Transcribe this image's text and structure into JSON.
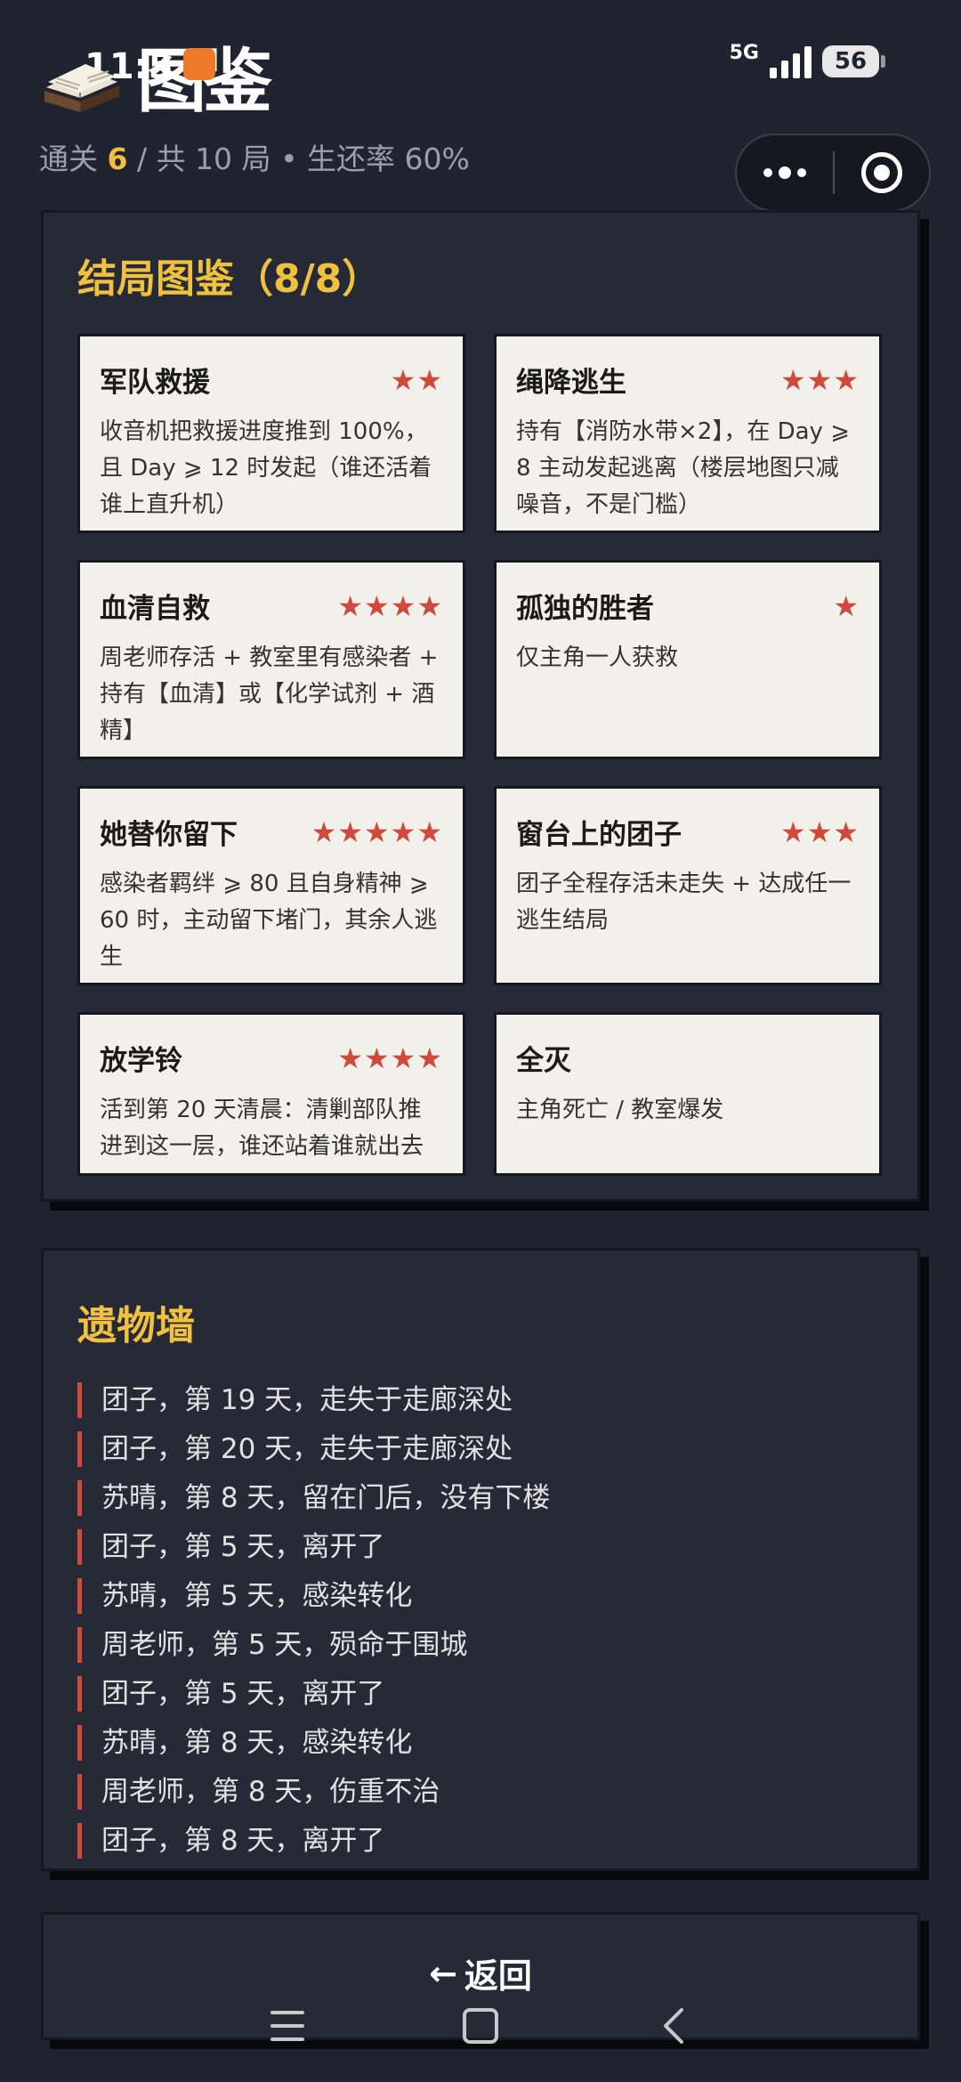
{
  "status_bar": {
    "time": "11:5",
    "network": "5G",
    "battery": "56"
  },
  "header": {
    "logo_text": "图鉴",
    "stats": {
      "cleared_label": "通关",
      "cleared_value": "6",
      "total_text": "/ 共 10 局",
      "separator": "•",
      "survival_text": "生还率 60%"
    }
  },
  "endings": {
    "title": "结局图鉴（8/8）",
    "cards": [
      {
        "title": "军队救援",
        "stars": "★★",
        "desc": "收音机把救援进度推到 100%，且 Day ⩾ 12 时发起（谁还活着谁上直升机）"
      },
      {
        "title": "绳降逃生",
        "stars": "★★★",
        "desc": "持有【消防水带×2】，在 Day ⩾ 8 主动发起逃离（楼层地图只减噪音，不是门槛）"
      },
      {
        "title": "血清自救",
        "stars": "★★★★",
        "desc": "周老师存活 + 教室里有感染者 + 持有【血清】或【化学试剂 + 酒精】"
      },
      {
        "title": "孤独的胜者",
        "stars": "★",
        "desc": "仅主角一人获救"
      },
      {
        "title": "她替你留下",
        "stars": "★★★★★",
        "desc": "感染者羁绊 ⩾ 80 且自身精神 ⩾ 60 时，主动留下堵门，其余人逃生"
      },
      {
        "title": "窗台上的团子",
        "stars": "★★★",
        "desc": "团子全程存活未走失 + 达成任一逃生结局"
      },
      {
        "title": "放学铃",
        "stars": "★★★★",
        "desc": "活到第 20 天清晨：清剿部队推进到这一层，谁还站着谁就出去"
      },
      {
        "title": "全灭",
        "stars": "",
        "desc": "主角死亡 / 教室爆发"
      }
    ]
  },
  "relics": {
    "title": "遗物墙",
    "items": [
      "团子，第 19 天，走失于走廊深处",
      "团子，第 20 天，走失于走廊深处",
      "苏晴，第 8 天，留在门后，没有下楼",
      "团子，第 5 天，离开了",
      "苏晴，第 5 天，感染转化",
      "周老师，第 5 天，殒命于围城",
      "团子，第 5 天，离开了",
      "苏晴，第 8 天，感染转化",
      "周老师，第 8 天，伤重不治",
      "团子，第 8 天，离开了"
    ]
  },
  "back_button": {
    "arrow": "←",
    "label": "返回"
  },
  "colors": {
    "background": "#1f2430",
    "accent_gold": "#f0c040",
    "star_red": "#d04a3c",
    "card_bg": "#f2f0ea"
  }
}
